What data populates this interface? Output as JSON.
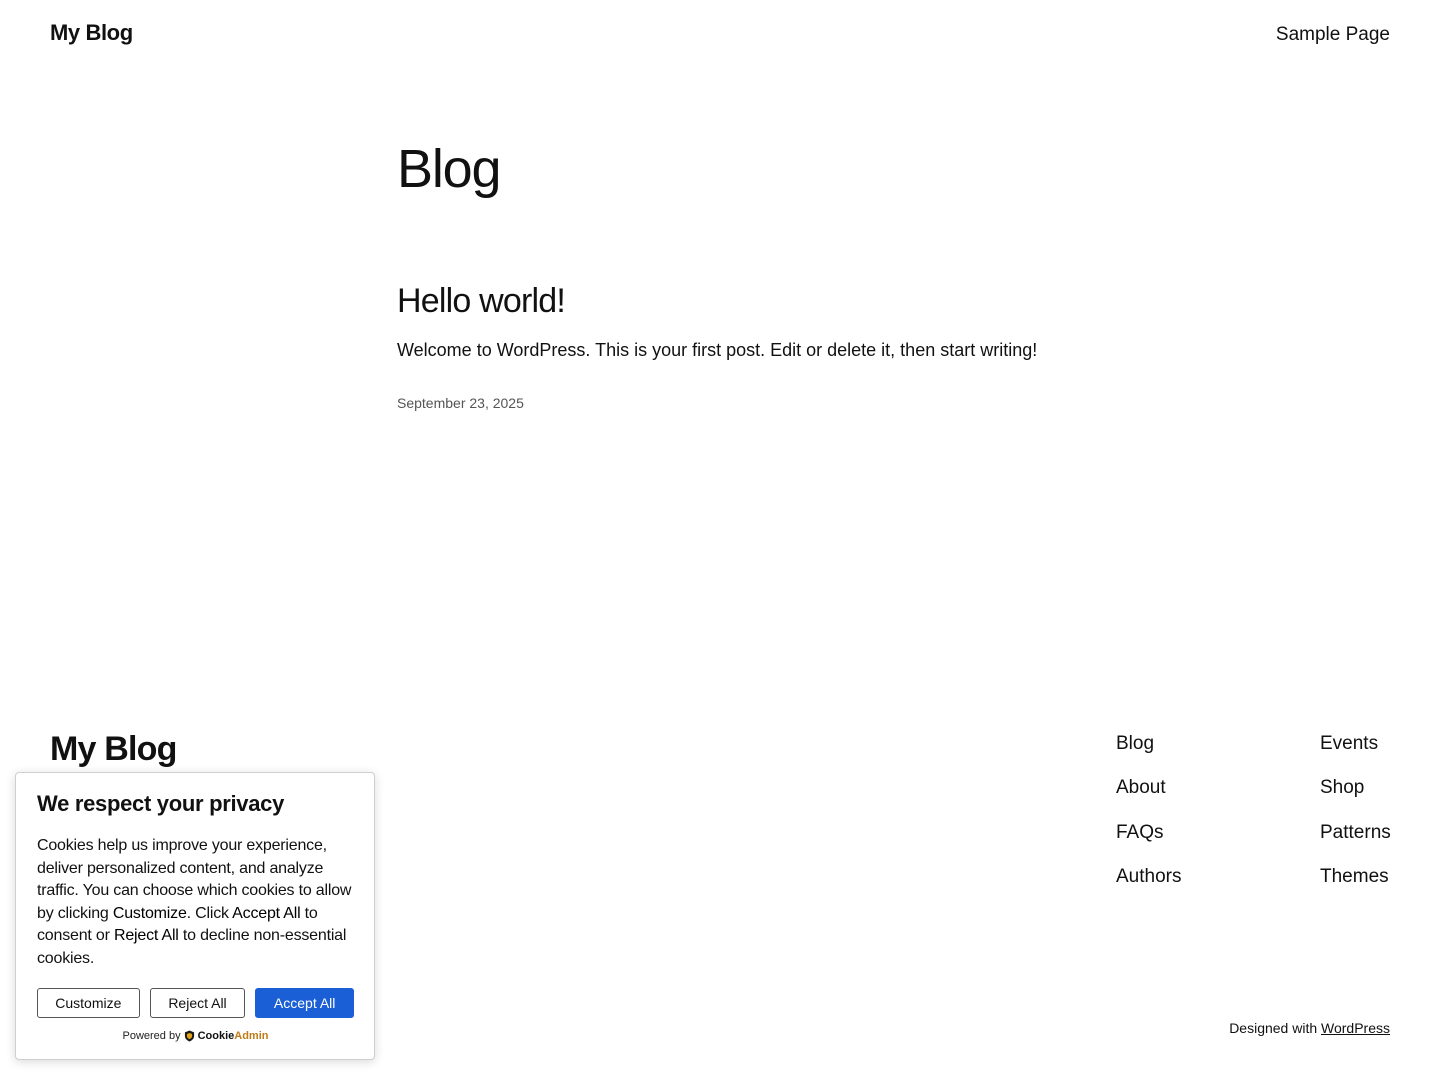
{
  "header": {
    "site_title": "My Blog",
    "nav_link": "Sample Page"
  },
  "main": {
    "page_title": "Blog",
    "post": {
      "title": "Hello world!",
      "excerpt": "Welcome to WordPress. This is your first post. Edit or delete it, then start writing!",
      "date": "September 23, 2025"
    }
  },
  "footer": {
    "site_title": "My Blog",
    "nav_col_1": [
      "Blog",
      "About",
      "FAQs",
      "Authors"
    ],
    "nav_col_2": [
      "Events",
      "Shop",
      "Patterns",
      "Themes"
    ],
    "designed_prefix": "Designed with ",
    "designed_link": "WordPress"
  },
  "cookie_banner": {
    "heading": "We respect your privacy",
    "text_1": "Cookies help us improve your experience, deliver personalized content, and analyze traffic. You can choose which cookies to allow by clicking ",
    "text_customize": "Customize",
    "text_2": ". Click ",
    "text_accept": "Accept All",
    "text_3": " to consent or ",
    "text_reject": "Reject All",
    "text_4": " to decline non-essential cookies.",
    "buttons": {
      "customize": "Customize",
      "reject": "Reject All",
      "accept": "Accept All"
    },
    "powered_by": "Powered by",
    "brand_part_1": "Cookie",
    "brand_part_2": "Admin",
    "accent_color": "#1a5fd6"
  }
}
